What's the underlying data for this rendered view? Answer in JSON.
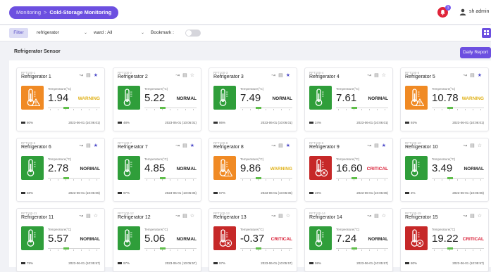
{
  "breadcrumb": {
    "root": "Monitoring",
    "current": "Cold-Storage Monitoring"
  },
  "header": {
    "notification_count": "1",
    "user": "sh admin"
  },
  "filters": {
    "button": "Filter",
    "device_select": "refrigerator",
    "ward_select": "ward : All",
    "bookmark_label": "Bookmark :"
  },
  "section": {
    "title": "Refrigerator Sensor",
    "report_button": "Daily Report"
  },
  "colors": {
    "warning": "#f08a24",
    "normal": "#2f9e3a",
    "critical": "#c62828",
    "accent": "#6c4fe0"
  },
  "cards": [
    {
      "id": "RFT100-1",
      "name": "Refrigerator 1",
      "temp_label": "Temperature(°C)",
      "value": "1.94",
      "status": "WARNING",
      "state": "warning",
      "bookmarked": true,
      "battery": "80%",
      "timestamp": "2023-06-01 (10:06:01)"
    },
    {
      "id": "RFT100-2",
      "name": "Refrigerator 2",
      "temp_label": "Temperature(°C)",
      "value": "5.22",
      "status": "NORMAL",
      "state": "normal",
      "bookmarked": false,
      "battery": "48%",
      "timestamp": "2023-06-01 (10:06:01)"
    },
    {
      "id": "RFT100-3",
      "name": "Refrigerator 3",
      "temp_label": "Temperature(°C)",
      "value": "7.49",
      "status": "NORMAL",
      "state": "normal",
      "bookmarked": true,
      "battery": "86%",
      "timestamp": "2023-06-01 (10:06:01)"
    },
    {
      "id": "RFT100-4",
      "name": "Refrigerator 4",
      "temp_label": "Temperature(°C)",
      "value": "7.61",
      "status": "NORMAL",
      "state": "normal",
      "bookmarked": false,
      "battery": "24%",
      "timestamp": "2023-06-01 (10:06:01)"
    },
    {
      "id": "RFT100-5",
      "name": "Refrigerator 5",
      "temp_label": "Temperature(°C)",
      "value": "10.78",
      "status": "WARNING",
      "state": "warning",
      "bookmarked": true,
      "battery": "93%",
      "timestamp": "2023-06-01 (10:06:01)"
    },
    {
      "id": "RFT100-6",
      "name": "Refrigerator 6",
      "temp_label": "Temperature(°C)",
      "value": "2.78",
      "status": "NORMAL",
      "state": "normal",
      "bookmarked": true,
      "battery": "58%",
      "timestamp": "2023-06-01 (10:06:06)"
    },
    {
      "id": "RFT100-7",
      "name": "Refrigerator 7",
      "temp_label": "Temperature(°C)",
      "value": "4.85",
      "status": "NORMAL",
      "state": "normal",
      "bookmarked": true,
      "battery": "97%",
      "timestamp": "2023-06-01 (10:06:06)"
    },
    {
      "id": "RFT100-8",
      "name": "Refrigerator 8",
      "temp_label": "Temperature(°C)",
      "value": "9.86",
      "status": "WARNING",
      "state": "warning",
      "bookmarked": true,
      "battery": "67%",
      "timestamp": "2023-06-01 (10:06:06)"
    },
    {
      "id": "RFT100-9",
      "name": "Refrigerator 9",
      "temp_label": "Temperature(°C)",
      "value": "16.60",
      "status": "CRITICAL",
      "state": "critical",
      "bookmarked": true,
      "battery": "28%",
      "timestamp": "2023-06-01 (10:06:06)"
    },
    {
      "id": "RFT100-10",
      "name": "Refrigerator 10",
      "temp_label": "Temperature(°C)",
      "value": "3.49",
      "status": "NORMAL",
      "state": "normal",
      "bookmarked": false,
      "battery": "3%",
      "timestamp": "2023-06-01 (10:06:06)"
    },
    {
      "id": "RFT100-11",
      "name": "Refrigerator 11",
      "temp_label": "Temperature(°C)",
      "value": "5.57",
      "status": "NORMAL",
      "state": "normal",
      "bookmarked": false,
      "battery": "78%",
      "timestamp": "2023-06-01 (10:05:57)"
    },
    {
      "id": "RFT100-12",
      "name": "Refrigerator 12",
      "temp_label": "Temperature(°C)",
      "value": "5.06",
      "status": "NORMAL",
      "state": "normal",
      "bookmarked": false,
      "battery": "97%",
      "timestamp": "2023-06-01 (10:05:57)"
    },
    {
      "id": "RFT100-13",
      "name": "Refrigerator 13",
      "temp_label": "Temperature(°C)",
      "value": "-0.37",
      "status": "CRITICAL",
      "state": "critical",
      "bookmarked": false,
      "battery": "97%",
      "timestamp": "2023-06-01 (10:05:57)"
    },
    {
      "id": "RFT100-14",
      "name": "Refrigerator 14",
      "temp_label": "Temperature(°C)",
      "value": "7.24",
      "status": "NORMAL",
      "state": "normal",
      "bookmarked": false,
      "battery": "98%",
      "timestamp": "2023-06-01 (10:05:57)"
    },
    {
      "id": "RFT100-15",
      "name": "Refrigerator 15",
      "temp_label": "Temperature(°C)",
      "value": "19.22",
      "status": "CRITICAL",
      "state": "critical",
      "bookmarked": false,
      "battery": "80%",
      "timestamp": "2023-06-01 (10:05:57)"
    }
  ]
}
